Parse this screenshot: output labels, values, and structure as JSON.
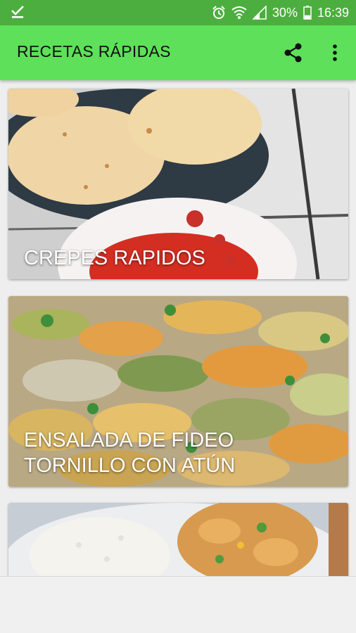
{
  "status_bar": {
    "notification_icon": "download-done-icon",
    "alarm_icon": "alarm-icon",
    "wifi_icon": "wifi-icon",
    "signal_icon": "signal-icon",
    "battery_percent": "30%",
    "battery_level": 0.3,
    "time": "16:39"
  },
  "app_bar": {
    "title": "RECETAS RÁPIDAS",
    "share_icon": "share-icon",
    "more_icon": "more-vert-icon",
    "color": "#5ee05a",
    "status_color": "#4cae3f"
  },
  "recipes": [
    {
      "title": "CREPES RAPIDOS"
    },
    {
      "title": "ENSALADA DE FIDEO\nTORNILLO CON ATÚN"
    },
    {
      "title": ""
    }
  ]
}
